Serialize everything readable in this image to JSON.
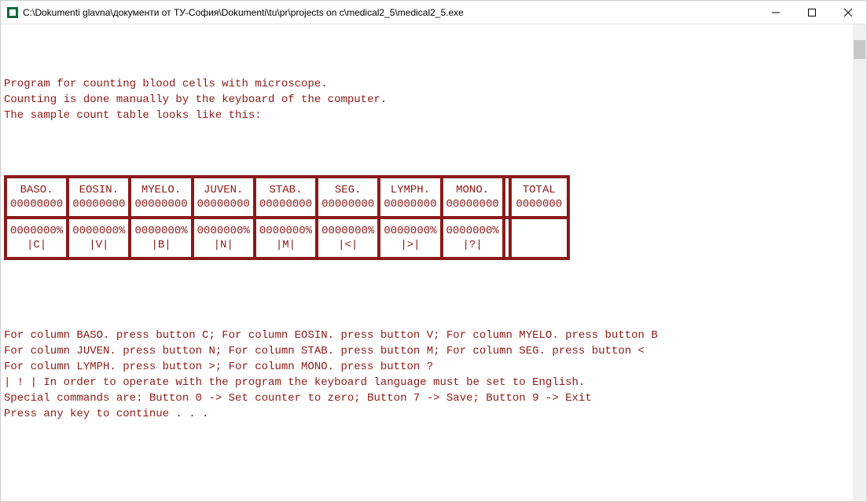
{
  "window": {
    "title": "C:\\Dokumenti glavna\\документи от ТУ-София\\Dokumenti\\tu\\pr\\projects on c\\medical2_5\\medical2_5.exe"
  },
  "intro": {
    "line1": "Program for counting blood cells with microscope.",
    "line2": "Counting is done manually by the keyboard of the computer.",
    "line3": "The sample count table looks like this:"
  },
  "table": {
    "cols": [
      {
        "name": "BASO.",
        "count": "00000000",
        "pct": "0000000%",
        "key": "|C|"
      },
      {
        "name": "EOSIN.",
        "count": "00000000",
        "pct": "0000000%",
        "key": "|V|"
      },
      {
        "name": "MYELO.",
        "count": "00000000",
        "pct": "0000000%",
        "key": "|B|"
      },
      {
        "name": "JUVEN.",
        "count": "00000000",
        "pct": "0000000%",
        "key": "|N|"
      },
      {
        "name": "STAB.",
        "count": "00000000",
        "pct": "0000000%",
        "key": "|M|"
      },
      {
        "name": "SEG.",
        "count": "00000000",
        "pct": "0000000%",
        "key": "|<|"
      },
      {
        "name": "LYMPH.",
        "count": "00000000",
        "pct": "0000000%",
        "key": "|>|"
      },
      {
        "name": "MONO.",
        "count": "00000000",
        "pct": "0000000%",
        "key": "|?|"
      }
    ],
    "total_label": "TOTAL",
    "total_count": "0000000"
  },
  "outro": {
    "l1": "For column BASO. press button C; For column EOSIN. press button V; For column MYELO. press button B",
    "l2": "For column JUVEN. press button N; For column STAB. press button M; For column SEG. press button <",
    "l3": "For column LYMPH. press button >; For column MONO. press button ?",
    "l4": "| ! | In order to operate with the program the keyboard language must be set to English.",
    "l5": "Special commands are: Button 0 -> Set counter to zero; Button 7 -> Save; Button 9 -> Exit",
    "l6": "Press any key to continue . . ."
  }
}
